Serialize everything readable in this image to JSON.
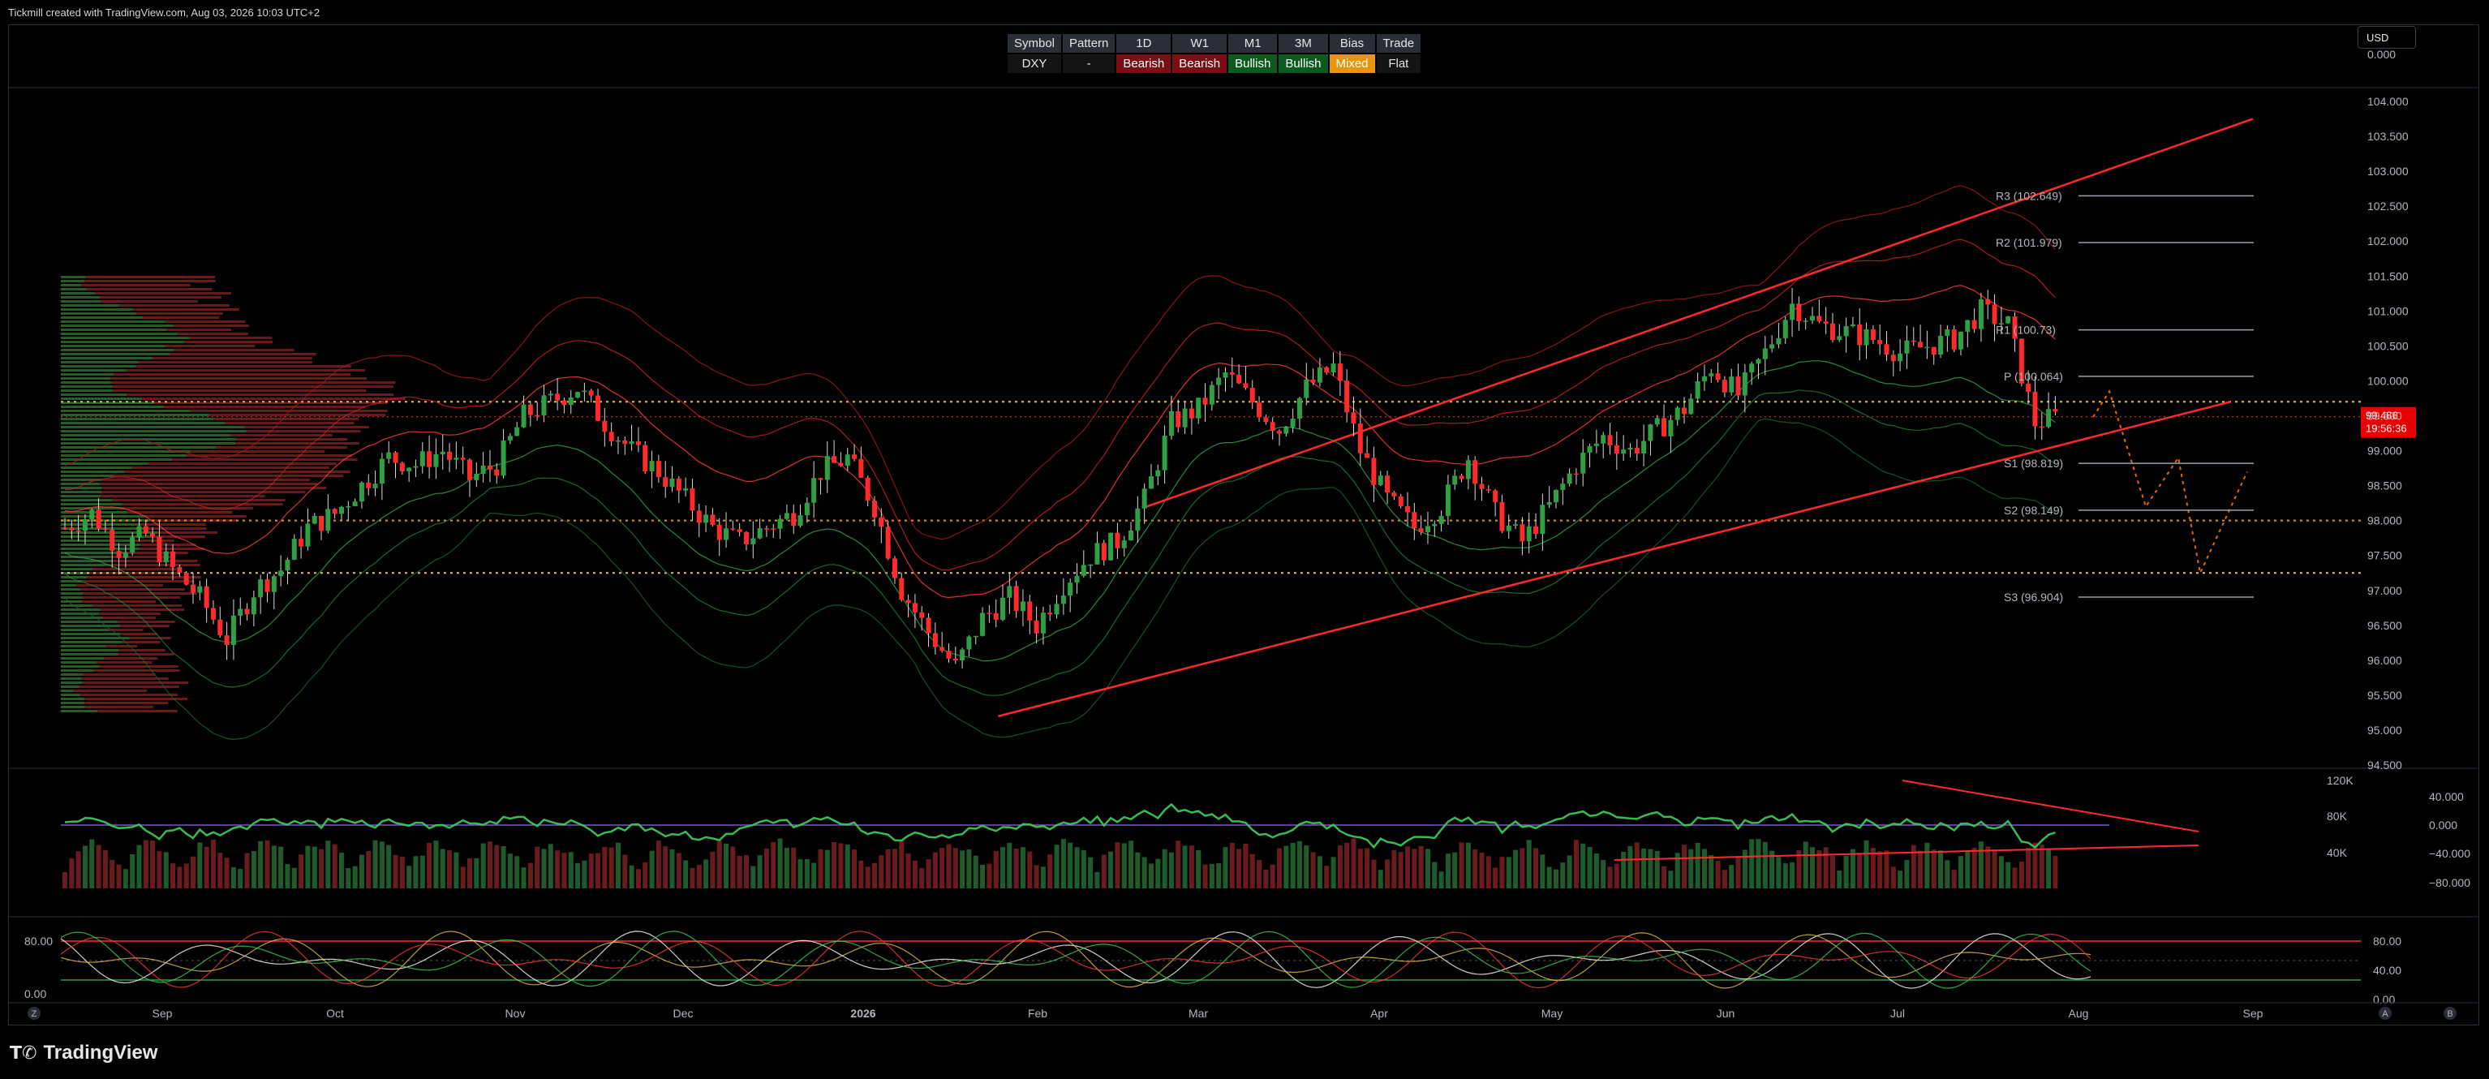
{
  "header": {
    "attribution": "Tickmill created with TradingView.com, Aug 03, 2026 10:03 UTC+2"
  },
  "currency_selector": {
    "value": "USD"
  },
  "status_table": {
    "headers": [
      "Symbol",
      "Pattern",
      "1D",
      "W1",
      "M1",
      "3M",
      "Bias",
      "Trade"
    ],
    "values": [
      {
        "text": "DXY",
        "state": "plain"
      },
      {
        "text": "-",
        "state": "plain"
      },
      {
        "text": "Bearish",
        "state": "bear"
      },
      {
        "text": "Bearish",
        "state": "bear"
      },
      {
        "text": "Bullish",
        "state": "bull"
      },
      {
        "text": "Bullish",
        "state": "bull"
      },
      {
        "text": "Mixed",
        "state": "mixed"
      },
      {
        "text": "Flat",
        "state": "plain"
      }
    ]
  },
  "chart_data": {
    "type": "candlestick",
    "symbol": "DXY",
    "price_axis": {
      "ticks": [
        "104.000",
        "103.500",
        "103.000",
        "102.500",
        "102.000",
        "101.500",
        "101.000",
        "100.500",
        "100.000",
        "99.500",
        "99.000",
        "98.500",
        "98.000",
        "97.500",
        "97.000",
        "96.500",
        "96.000",
        "95.500",
        "95.000",
        "94.500"
      ],
      "range": [
        94.5,
        104.0
      ]
    },
    "time_axis": {
      "labels": [
        "Sep",
        "Oct",
        "Nov",
        "Dec",
        "2026",
        "Feb",
        "Mar",
        "Apr",
        "May",
        "Jun",
        "Jul",
        "Aug",
        "Sep"
      ]
    },
    "last_price": {
      "price": "99.486",
      "countdown": "19:56:36"
    },
    "top_axis_partial": "0.000",
    "pivot_levels": [
      {
        "label": "R3 (102.649)",
        "value": 102.649
      },
      {
        "label": "R2 (101.979)",
        "value": 101.979
      },
      {
        "label": "R1 (100.73)",
        "value": 100.73
      },
      {
        "label": "P (100.064)",
        "value": 100.064
      },
      {
        "label": "S1 (98.819)",
        "value": 98.819
      },
      {
        "label": "S2 (98.149)",
        "value": 98.149
      },
      {
        "label": "S3 (96.904)",
        "value": 96.904
      }
    ],
    "horizontal_levels": [
      99.7,
      98.0,
      97.25
    ],
    "channel": {
      "upper": [
        {
          "date": "2026-02-20",
          "price": 98.2
        },
        {
          "date": "2026-09-10",
          "price": 103.75
        }
      ],
      "lower": [
        {
          "date": "2026-01-25",
          "price": 95.2
        },
        {
          "date": "2026-08-28",
          "price": 99.7
        }
      ]
    },
    "projection_path": [
      99.48,
      99.85,
      98.2,
      98.9,
      97.25,
      98.7
    ],
    "close_series": [
      97.9,
      98.1,
      97.6,
      97.8,
      97.3,
      96.9,
      96.3,
      97.0,
      97.3,
      97.9,
      98.1,
      98.5,
      98.9,
      98.8,
      99.0,
      98.6,
      98.8,
      99.5,
      99.7,
      99.9,
      99.4,
      99.0,
      98.7,
      98.3,
      97.9,
      97.7,
      97.9,
      98.1,
      98.7,
      98.9,
      98.2,
      97.0,
      96.4,
      95.9,
      96.6,
      96.9,
      96.5,
      97.1,
      97.5,
      97.7,
      98.3,
      99.4,
      99.6,
      100.1,
      99.7,
      99.3,
      99.9,
      100.2,
      99.0,
      98.3,
      97.9,
      98.2,
      98.9,
      98.1,
      97.7,
      98.2,
      98.8,
      99.2,
      99.0,
      99.3,
      99.6,
      100.2,
      99.8,
      100.4,
      101.1,
      100.8,
      100.7,
      100.6,
      100.4,
      100.5,
      100.6,
      101.0,
      100.8,
      99.4,
      99.5
    ],
    "volume_axis": {
      "ticks": [
        "120K",
        "80K",
        "40K"
      ]
    },
    "oscillator1": {
      "ticks": [
        "40.000",
        "0.000",
        "−40.000",
        "−80.000"
      ]
    },
    "oscillator2": {
      "ticks": [
        "80.00",
        "40.00",
        "0.00"
      ],
      "left_ticks": [
        "80.00",
        "0.00"
      ]
    },
    "axis_buttons": {
      "left": "Z",
      "a": "A",
      "b": "B"
    }
  },
  "footer": {
    "brand": "TradingView"
  }
}
